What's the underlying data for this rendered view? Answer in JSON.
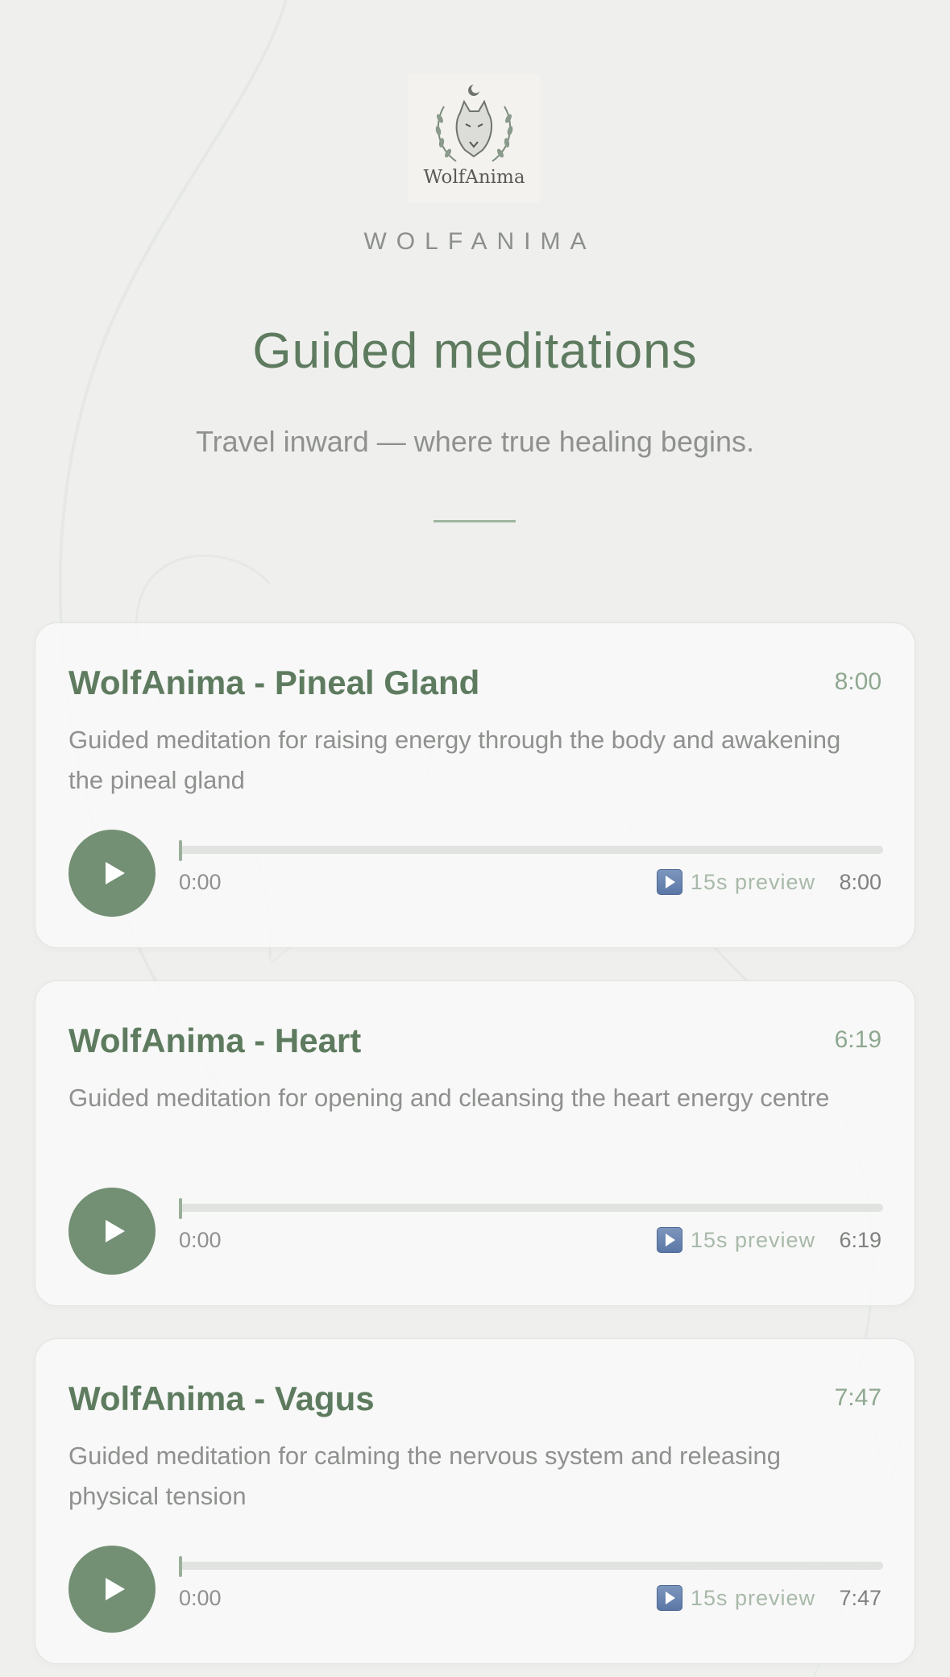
{
  "brand": {
    "logo_text": "WolfAnima",
    "name": "WOLFANIMA"
  },
  "page": {
    "title": "Guided meditations",
    "subtitle": "Travel inward — where true healing begins."
  },
  "colors": {
    "accent": "#5e7b5f",
    "play_button": "#738f74",
    "muted_text": "#8f918f",
    "background": "#eff0ee"
  },
  "icons": {
    "play": "play-icon",
    "preview": "preview-play-icon",
    "logo": "wolf-logo-icon"
  },
  "meditations": [
    {
      "title": "WolfAnima - Pineal Gland",
      "duration": "8:00",
      "description": "Guided meditation for raising energy through the body and awakening the pineal gland",
      "current_time": "0:00",
      "preview_label": "15s preview",
      "end_time": "8:00",
      "progress": 0
    },
    {
      "title": "WolfAnima - Heart",
      "duration": "6:19",
      "description": "Guided meditation for opening and cleansing the heart energy centre",
      "current_time": "0:00",
      "preview_label": "15s preview",
      "end_time": "6:19",
      "progress": 0
    },
    {
      "title": "WolfAnima - Vagus",
      "duration": "7:47",
      "description": "Guided meditation for calming the nervous system and releasing physical tension",
      "current_time": "0:00",
      "preview_label": "15s preview",
      "end_time": "7:47",
      "progress": 0
    }
  ]
}
